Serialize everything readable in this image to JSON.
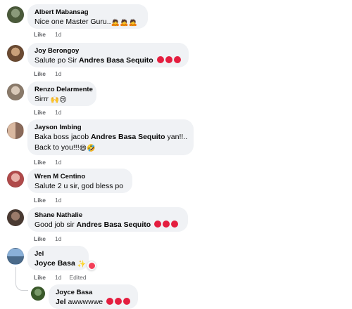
{
  "comments": [
    {
      "author": "Albert Mabansag",
      "text": "Nice one Master Guru..",
      "emojis": "🙇🙇🙇",
      "like_label": "Like",
      "time": "1d"
    },
    {
      "author": "Joy Berongoy",
      "text_prefix": "Salute po Sir ",
      "mention": "Andres Basa Sequito",
      "emojis": "",
      "like_label": "Like",
      "time": "1d"
    },
    {
      "author": "Renzo Delarmente",
      "text": "Sirrr ",
      "emojis": "🙌😢",
      "like_label": "Like",
      "time": "1d"
    },
    {
      "author": "Jayson Imbing",
      "text_prefix": "Baka boss jacob ",
      "mention": "Andres Basa Sequito",
      "text_suffix": " yan!!..",
      "text_line2": "Back to you!!!",
      "emojis": "😄🤣",
      "like_label": "Like",
      "time": "1d"
    },
    {
      "author": "Wren M Centino",
      "text": "Salute 2 u sir, god bless po",
      "like_label": "Like",
      "time": "1d"
    },
    {
      "author": "Shane Nathalie",
      "text_prefix": "Good job sir ",
      "mention": "Andres Basa Sequito",
      "like_label": "Like",
      "time": "1d"
    },
    {
      "author": "Jel",
      "mention": "Joyce Basa",
      "emojis": "✨",
      "like_label": "Like",
      "time": "1d",
      "edited_label": "Edited"
    },
    {
      "author": "Joyce Basa",
      "mention": "Jel",
      "text_suffix": " awwwwwe",
      "like_label": "Like",
      "time": "1d"
    }
  ],
  "colors": {
    "bubble": "#f0f2f5",
    "heart": "#e41e3f",
    "meta": "#65676b"
  }
}
